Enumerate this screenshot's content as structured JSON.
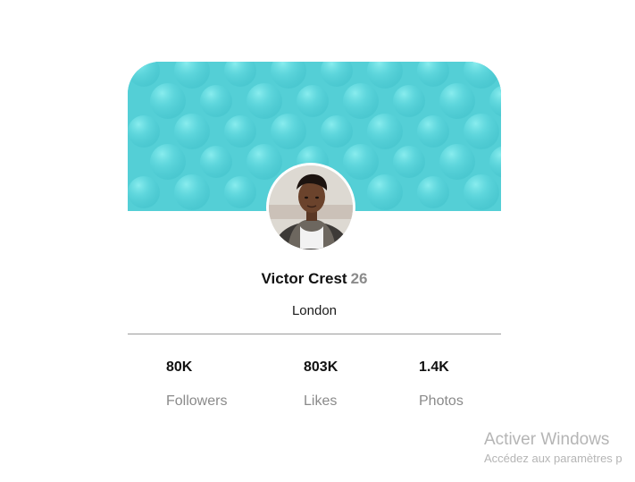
{
  "profile": {
    "name": "Victor Crest",
    "age": "26",
    "location": "London"
  },
  "stats": [
    {
      "value": "80K",
      "label": "Followers"
    },
    {
      "value": "803K",
      "label": "Likes"
    },
    {
      "value": "1.4K",
      "label": "Photos"
    }
  ],
  "watermark": {
    "title": "Activer Windows",
    "subtitle": "Accédez aux paramètres p"
  },
  "colors": {
    "cover": "#54cfd6",
    "age": "#8b8b8b",
    "label": "#8a8a8a",
    "divider": "#9a9a9a"
  },
  "icons": {
    "cover": "bubble-pattern",
    "avatar": "person-photo"
  }
}
